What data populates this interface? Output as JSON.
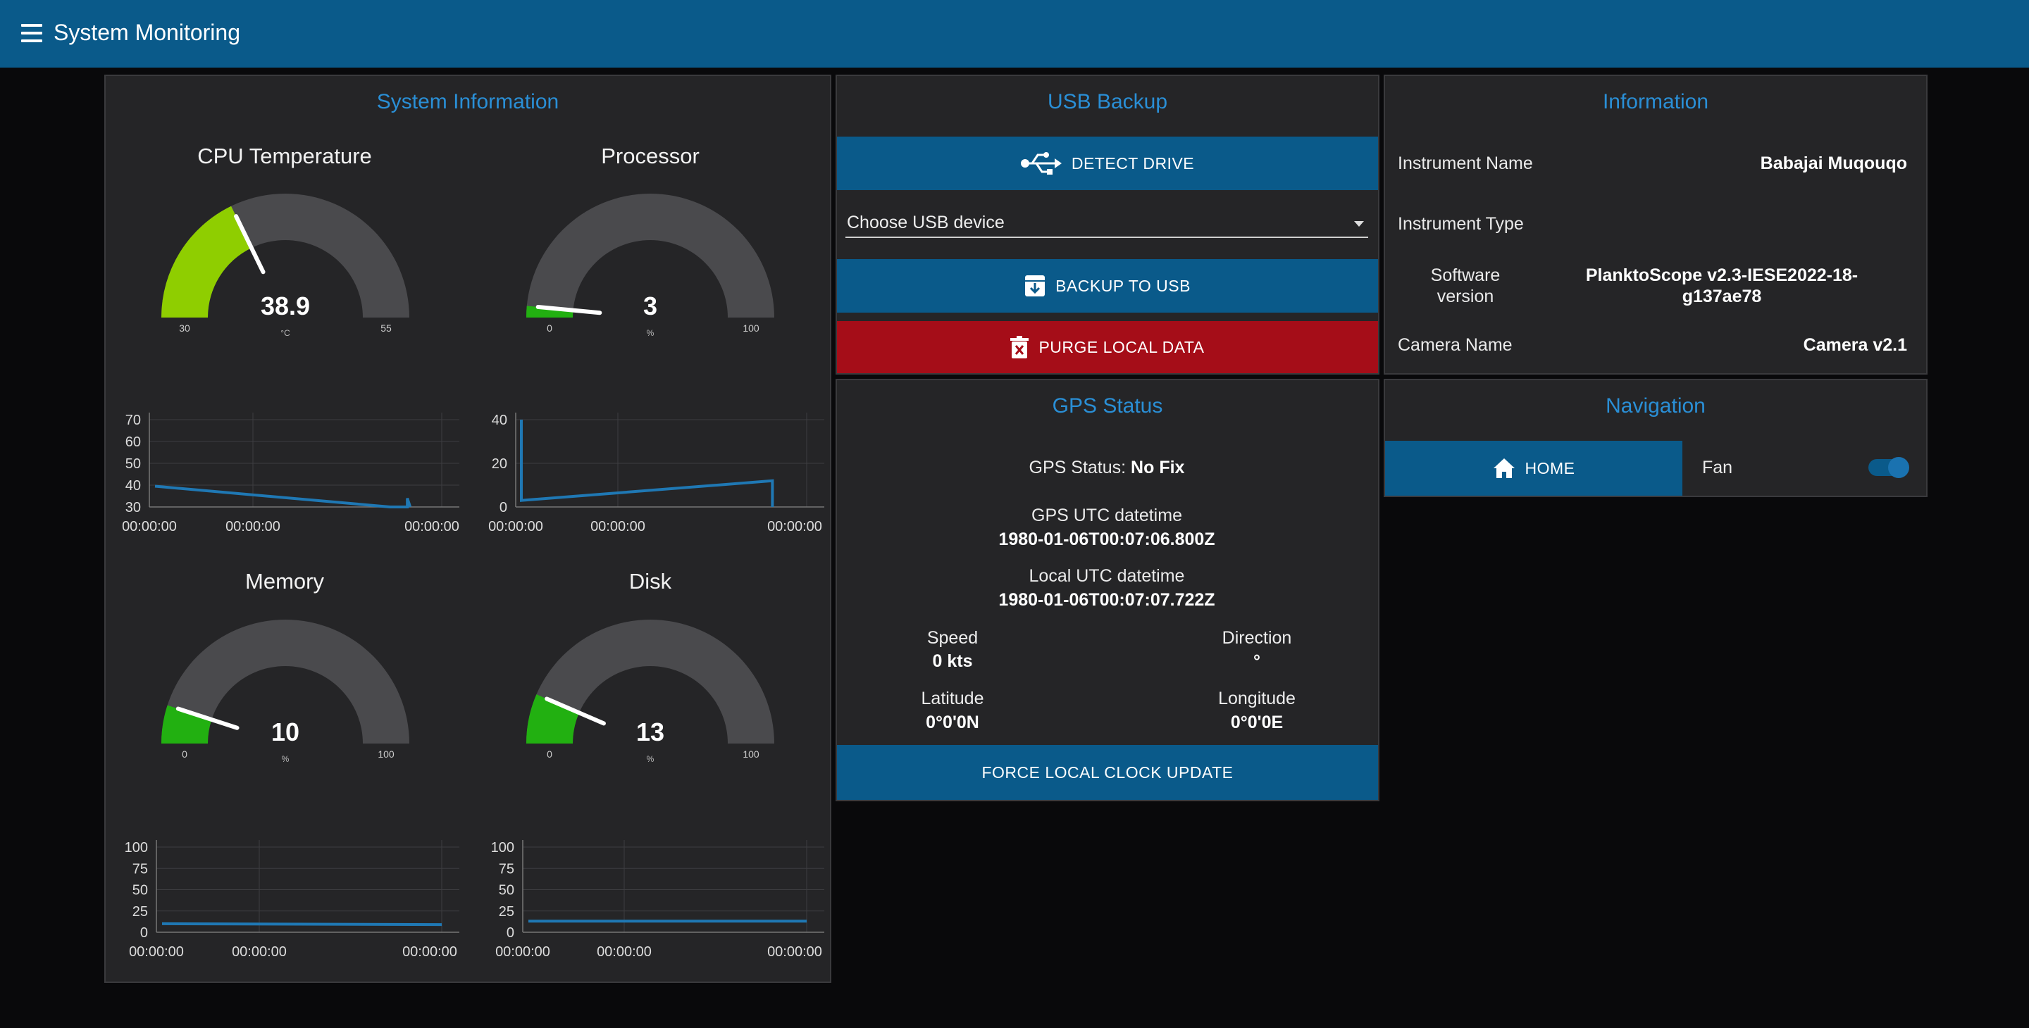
{
  "app": {
    "title": "System Monitoring"
  },
  "colors": {
    "accent": "#0a5a8a",
    "danger": "#a50d18",
    "title": "#2a8fd6",
    "gauge_ok": "#22b011",
    "gauge_warn": "#8fce00",
    "gauge_track": "#4a4a4d",
    "line": "#1f78b4"
  },
  "system_info": {
    "title": "System Information",
    "gauges": [
      {
        "key": "cpu",
        "title": "CPU Temperature",
        "value": "38.9",
        "unit": "°C",
        "min": "30",
        "max": "55",
        "num": {
          "value": 38.9,
          "min": 30,
          "max": 55
        },
        "fill_color": "#8fce00"
      },
      {
        "key": "proc",
        "title": "Processor",
        "value": "3",
        "unit": "%",
        "min": "0",
        "max": "100",
        "num": {
          "value": 3,
          "min": 0,
          "max": 100
        },
        "fill_color": "#22b011"
      },
      {
        "key": "mem",
        "title": "Memory",
        "value": "10",
        "unit": "%",
        "min": "0",
        "max": "100",
        "num": {
          "value": 10,
          "min": 0,
          "max": 100
        },
        "fill_color": "#22b011"
      },
      {
        "key": "disk",
        "title": "Disk",
        "value": "13",
        "unit": "%",
        "min": "0",
        "max": "100",
        "num": {
          "value": 13,
          "min": 0,
          "max": 100
        },
        "fill_color": "#22b011"
      }
    ]
  },
  "chart_data": [
    {
      "type": "line",
      "name": "cpu-temperature-history",
      "yticks": [
        "70",
        "60",
        "50",
        "40",
        "30"
      ],
      "ylim": [
        30,
        70
      ],
      "xticks": [
        "00:00:00",
        "00:00:00",
        "00:00:00"
      ],
      "series": [
        {
          "points": [
            [
              0,
              39.5
            ],
            [
              0.82,
              30
            ],
            [
              0.88,
              30
            ],
            [
              0.88,
              34
            ],
            [
              0.89,
              30
            ]
          ]
        }
      ]
    },
    {
      "type": "line",
      "name": "processor-history",
      "yticks": [
        "40",
        "20",
        "0"
      ],
      "ylim": [
        0,
        40
      ],
      "xticks": [
        "00:00:00",
        "00:00:00",
        "00:00:00"
      ],
      "series": [
        {
          "points": [
            [
              0,
              40
            ],
            [
              0,
              3
            ],
            [
              0.88,
              12
            ],
            [
              0.88,
              0
            ]
          ]
        }
      ]
    },
    {
      "type": "line",
      "name": "memory-history",
      "yticks": [
        "100",
        "75",
        "50",
        "25",
        "0"
      ],
      "ylim": [
        0,
        100
      ],
      "xticks": [
        "00:00:00",
        "00:00:00",
        "00:00:00"
      ],
      "series": [
        {
          "points": [
            [
              0,
              10
            ],
            [
              1,
              9
            ]
          ]
        }
      ]
    },
    {
      "type": "line",
      "name": "disk-history",
      "yticks": [
        "100",
        "75",
        "50",
        "25",
        "0"
      ],
      "ylim": [
        0,
        100
      ],
      "xticks": [
        "00:00:00",
        "00:00:00",
        "00:00:00"
      ],
      "series": [
        {
          "points": [
            [
              0,
              13
            ],
            [
              1,
              13
            ]
          ]
        }
      ]
    }
  ],
  "usb_backup": {
    "title": "USB Backup",
    "detect_label": "DETECT DRIVE",
    "select_label": "Choose USB device",
    "backup_label": "BACKUP TO USB",
    "purge_label": "PURGE LOCAL DATA"
  },
  "information": {
    "title": "Information",
    "rows": [
      {
        "label": "Instrument Name",
        "value": "Babajai Muqouqo"
      },
      {
        "label": "Instrument Type",
        "value": ""
      },
      {
        "label": "Software version",
        "value": "PlanktoScope v2.3-IESE2022-18-g137ae78"
      },
      {
        "label": "Camera Name",
        "value": "Camera v2.1"
      }
    ]
  },
  "gps": {
    "title": "GPS Status",
    "status_prefix": "GPS Status: ",
    "status_value": "No Fix",
    "utc_label": "GPS UTC datetime",
    "utc_value": "1980-01-06T00:07:06.800Z",
    "local_label": "Local UTC datetime",
    "local_value": "1980-01-06T00:07:07.722Z",
    "speed_label": "Speed",
    "speed_value": "0 kts",
    "direction_label": "Direction",
    "direction_value": "°",
    "latitude_label": "Latitude",
    "latitude_value": "0°0'0N",
    "longitude_label": "Longitude",
    "longitude_value": "0°0'0E",
    "force_label": "FORCE LOCAL CLOCK UPDATE"
  },
  "navigation": {
    "title": "Navigation",
    "home_label": "HOME",
    "fan_label": "Fan",
    "fan_on": true
  }
}
